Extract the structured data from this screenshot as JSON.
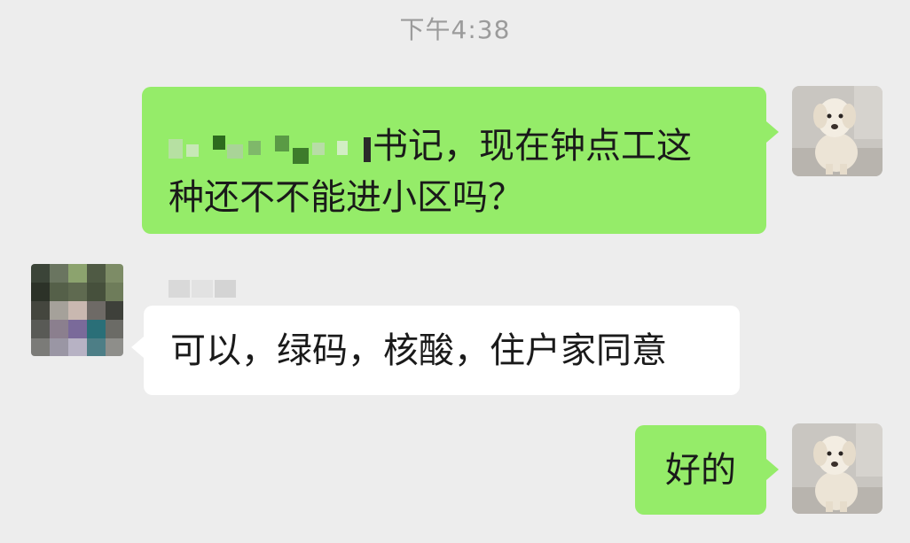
{
  "chat": {
    "timestamp": "下午4:38",
    "messages": [
      {
        "id": 1,
        "direction": "sent",
        "text_line1": "书记，现在钟点工这",
        "text_line2": "种还不不能进小区吗？",
        "has_redacted_prefix": true
      },
      {
        "id": 2,
        "direction": "received",
        "text": "可以，绿码，核酸，住户家同意",
        "sender_name_redacted": true
      },
      {
        "id": 3,
        "direction": "sent",
        "text": "好的"
      }
    ]
  },
  "colors": {
    "background": "#ededed",
    "sent_bubble": "#95ec69",
    "received_bubble": "#ffffff",
    "timestamp_text": "#9b9b9b",
    "message_text": "#1a1a1a"
  },
  "avatars": {
    "self": "dog-avatar-icon",
    "other": "pixelated-avatar-icon"
  }
}
